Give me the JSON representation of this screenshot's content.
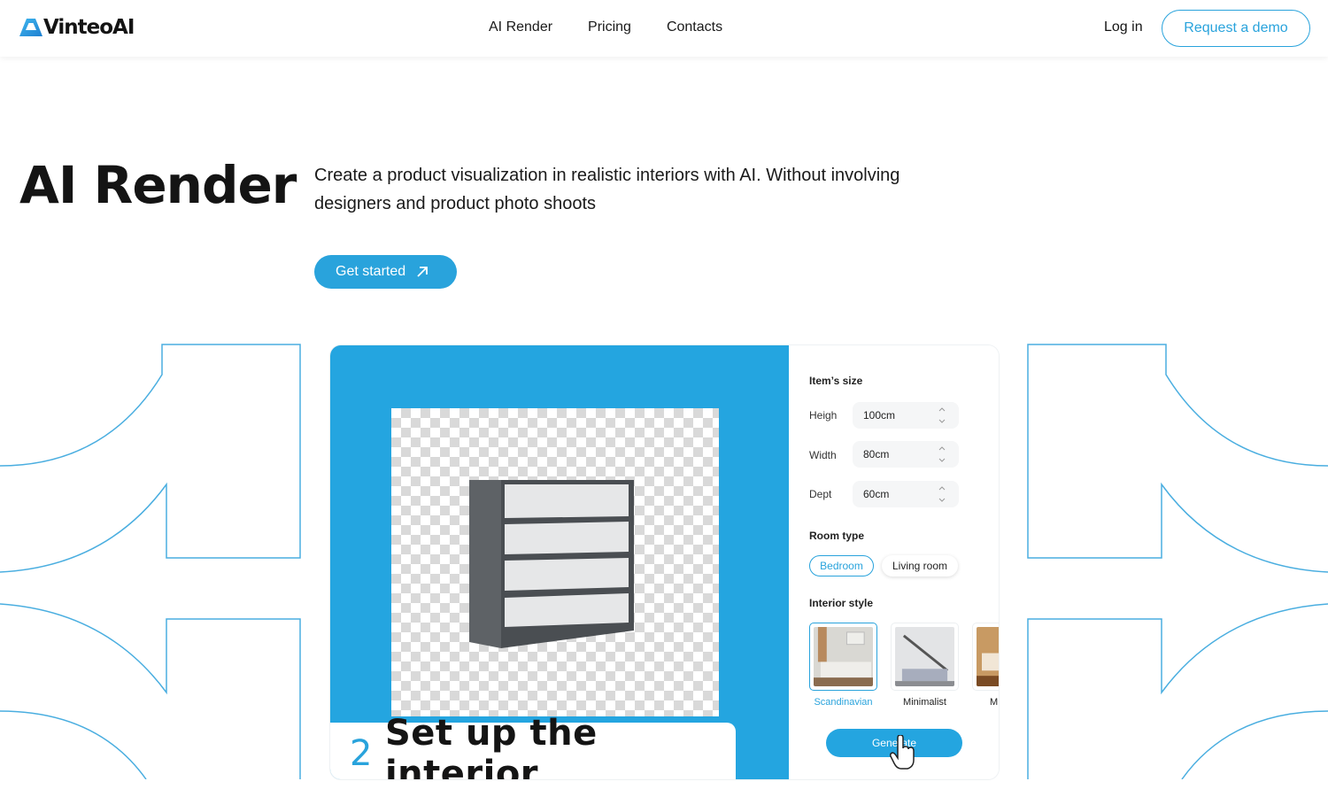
{
  "header": {
    "logo_text": "VinteoAI",
    "nav": [
      {
        "label": "AI Render"
      },
      {
        "label": "Pricing"
      },
      {
        "label": "Contacts"
      }
    ],
    "login_label": "Log in",
    "demo_label": "Request a demo"
  },
  "hero": {
    "title": "AI Render",
    "description": "Create a product visualization in realistic interiors with AI. Without involving designers and product photo shoots",
    "cta_label": "Get started",
    "cta_icon": "arrow-up-right-icon"
  },
  "demo": {
    "step_number": "2",
    "step_text": "Set up the interior",
    "panel": {
      "size_heading": "Item’s size",
      "fields": [
        {
          "label": "Heigh",
          "value": "100cm"
        },
        {
          "label": "Width",
          "value": "80cm"
        },
        {
          "label": "Dept",
          "value": "60cm"
        }
      ],
      "room_heading": "Room type",
      "room_types": [
        {
          "label": "Bedroom",
          "selected": true
        },
        {
          "label": "Living room",
          "selected": false
        }
      ],
      "style_heading": "Interior style",
      "styles": [
        {
          "label": "Scandinavian",
          "selected": true
        },
        {
          "label": "Minimalist",
          "selected": false
        },
        {
          "label": "M",
          "selected": false
        }
      ],
      "generate_label": "Generate"
    }
  },
  "colors": {
    "accent": "#29a3dc",
    "text": "#141414"
  }
}
